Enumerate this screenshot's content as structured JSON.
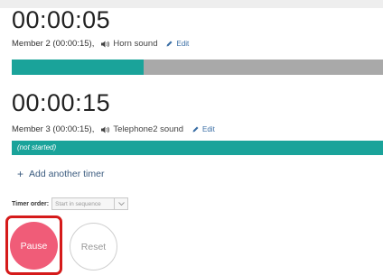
{
  "timers": [
    {
      "time": "00:00:05",
      "member": "Member 2 (00:00:15),",
      "sound": "Horn  sound",
      "edit": "Edit",
      "progress": 0.355,
      "status": ""
    },
    {
      "time": "00:00:15",
      "member": "Member 3 (00:00:15),",
      "sound": "Telephone2  sound",
      "edit": "Edit",
      "progress": 0,
      "status": "(not started)"
    }
  ],
  "add_timer_label": "Add another timer",
  "timer_order": {
    "label": "Timer order:",
    "value": "Start in sequence"
  },
  "buttons": {
    "pause": "Pause",
    "reset": "Reset"
  },
  "colors": {
    "teal": "#1aa39a",
    "gray_track": "#a9a9a9",
    "pause_pink": "#f05c78",
    "focus_red": "#d51a1a",
    "link_blue": "#3a6ea5"
  },
  "icons": {
    "sound": "speaker-icon",
    "edit": "pencil-icon",
    "add": "plus-icon",
    "dropdown": "chevron-down-icon"
  }
}
